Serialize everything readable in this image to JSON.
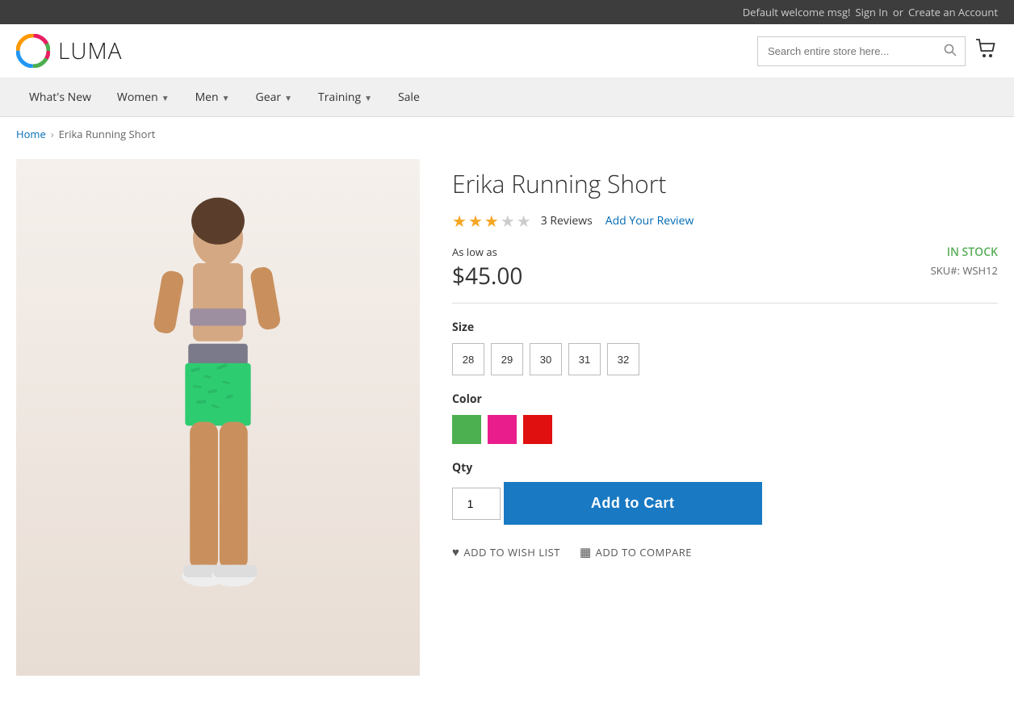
{
  "topbar": {
    "welcome": "Default welcome msg!",
    "signin": "Sign In",
    "or": "or",
    "create_account": "Create an Account"
  },
  "header": {
    "logo_text": "LUMA",
    "search_placeholder": "Search entire store here...",
    "cart_count": ""
  },
  "nav": {
    "items": [
      {
        "label": "What's New",
        "has_dropdown": false
      },
      {
        "label": "Women",
        "has_dropdown": true
      },
      {
        "label": "Men",
        "has_dropdown": true
      },
      {
        "label": "Gear",
        "has_dropdown": true
      },
      {
        "label": "Training",
        "has_dropdown": true
      },
      {
        "label": "Sale",
        "has_dropdown": false
      }
    ]
  },
  "breadcrumb": {
    "home": "Home",
    "current": "Erika Running Short"
  },
  "product": {
    "title": "Erika Running Short",
    "rating": 3,
    "max_rating": 5,
    "reviews_count": "3  Reviews",
    "add_review": "Add Your Review",
    "as_low_as": "As low as",
    "price": "$45.00",
    "in_stock": "IN STOCK",
    "sku_label": "SKU#:",
    "sku": "WSH12",
    "size_label": "Size",
    "sizes": [
      "28",
      "29",
      "30",
      "31",
      "32"
    ],
    "color_label": "Color",
    "colors": [
      {
        "name": "Green",
        "hex": "#4caf50"
      },
      {
        "name": "Pink",
        "hex": "#e91e8c"
      },
      {
        "name": "Red",
        "hex": "#e01010"
      }
    ],
    "qty_label": "Qty",
    "qty_value": "1",
    "add_to_cart": "Add to Cart",
    "add_to_wishlist": "ADD TO WISH LIST",
    "add_to_compare": "ADD TO COMPARE"
  }
}
